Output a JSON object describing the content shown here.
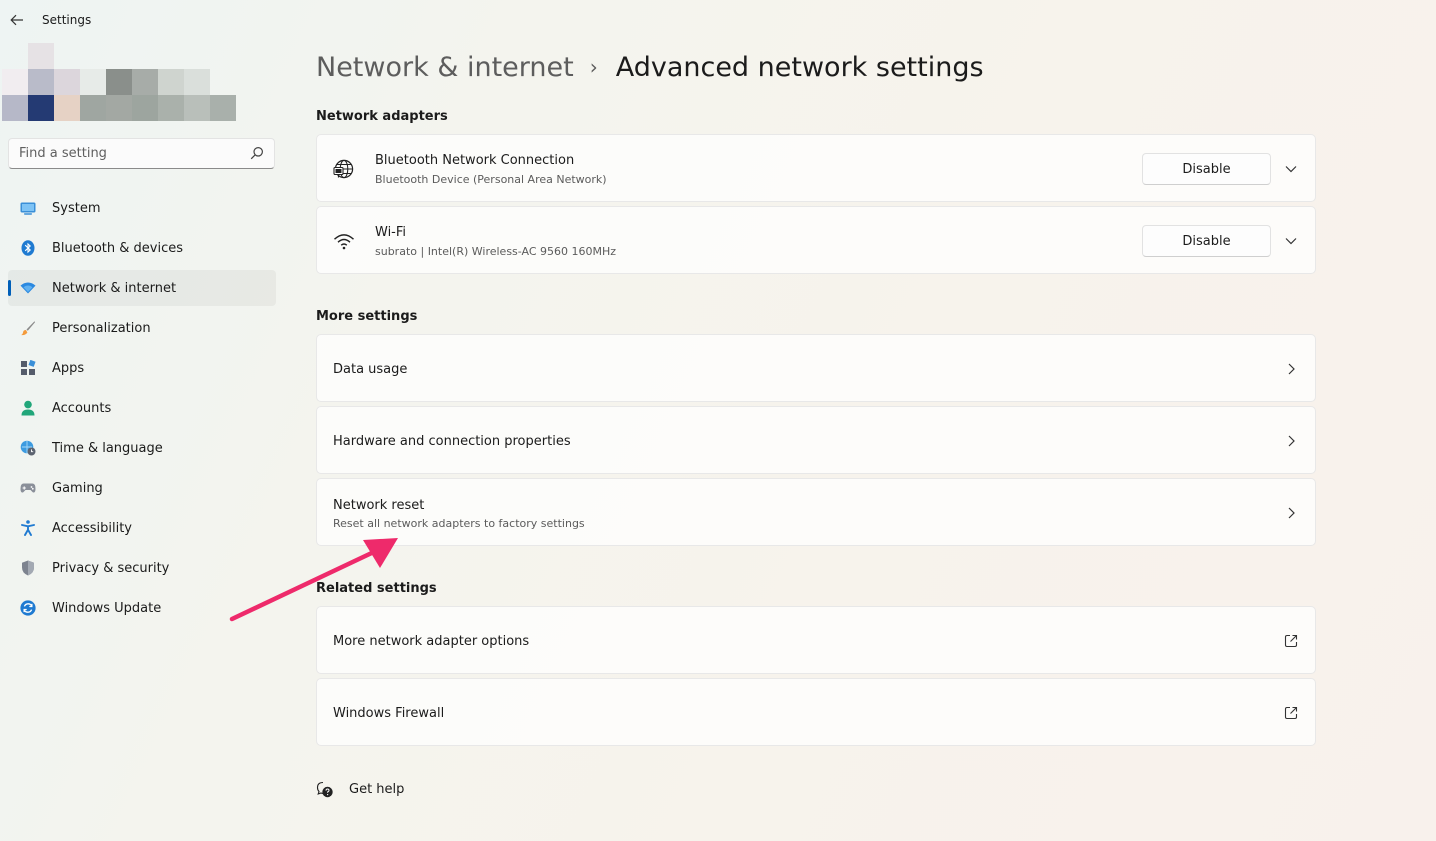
{
  "app": {
    "title": "Settings"
  },
  "search": {
    "placeholder": "Find a setting"
  },
  "sidebar": {
    "items": [
      {
        "label": "System",
        "icon": "system-icon"
      },
      {
        "label": "Bluetooth & devices",
        "icon": "bluetooth-icon"
      },
      {
        "label": "Network & internet",
        "icon": "network-icon",
        "active": true
      },
      {
        "label": "Personalization",
        "icon": "brush-icon"
      },
      {
        "label": "Apps",
        "icon": "apps-icon"
      },
      {
        "label": "Accounts",
        "icon": "person-icon"
      },
      {
        "label": "Time & language",
        "icon": "globe-clock-icon"
      },
      {
        "label": "Gaming",
        "icon": "gamepad-icon"
      },
      {
        "label": "Accessibility",
        "icon": "accessibility-icon"
      },
      {
        "label": "Privacy & security",
        "icon": "shield-icon"
      },
      {
        "label": "Windows Update",
        "icon": "refresh-icon"
      }
    ]
  },
  "breadcrumb": {
    "parent": "Network & internet",
    "separator": "›",
    "current": "Advanced network settings"
  },
  "adapters": {
    "heading": "Network adapters",
    "items": [
      {
        "title": "Bluetooth Network Connection",
        "subtitle": "Bluetooth Device (Personal Area Network)",
        "button": "Disable",
        "icon": "ethernet-globe-icon"
      },
      {
        "title": "Wi-Fi",
        "subtitle": "subrato | Intel(R) Wireless-AC 9560 160MHz",
        "button": "Disable",
        "icon": "wifi-icon"
      }
    ]
  },
  "more_settings": {
    "heading": "More settings",
    "items": [
      {
        "title": "Data usage"
      },
      {
        "title": "Hardware and connection properties"
      },
      {
        "title": "Network reset",
        "subtitle": "Reset all network adapters to factory settings"
      }
    ]
  },
  "related": {
    "heading": "Related settings",
    "items": [
      {
        "title": "More network adapter options"
      },
      {
        "title": "Windows Firewall"
      }
    ]
  },
  "help": {
    "label": "Get help"
  },
  "colors": {
    "accent": "#005fb8",
    "annotation_arrow": "#ee2a6b"
  }
}
